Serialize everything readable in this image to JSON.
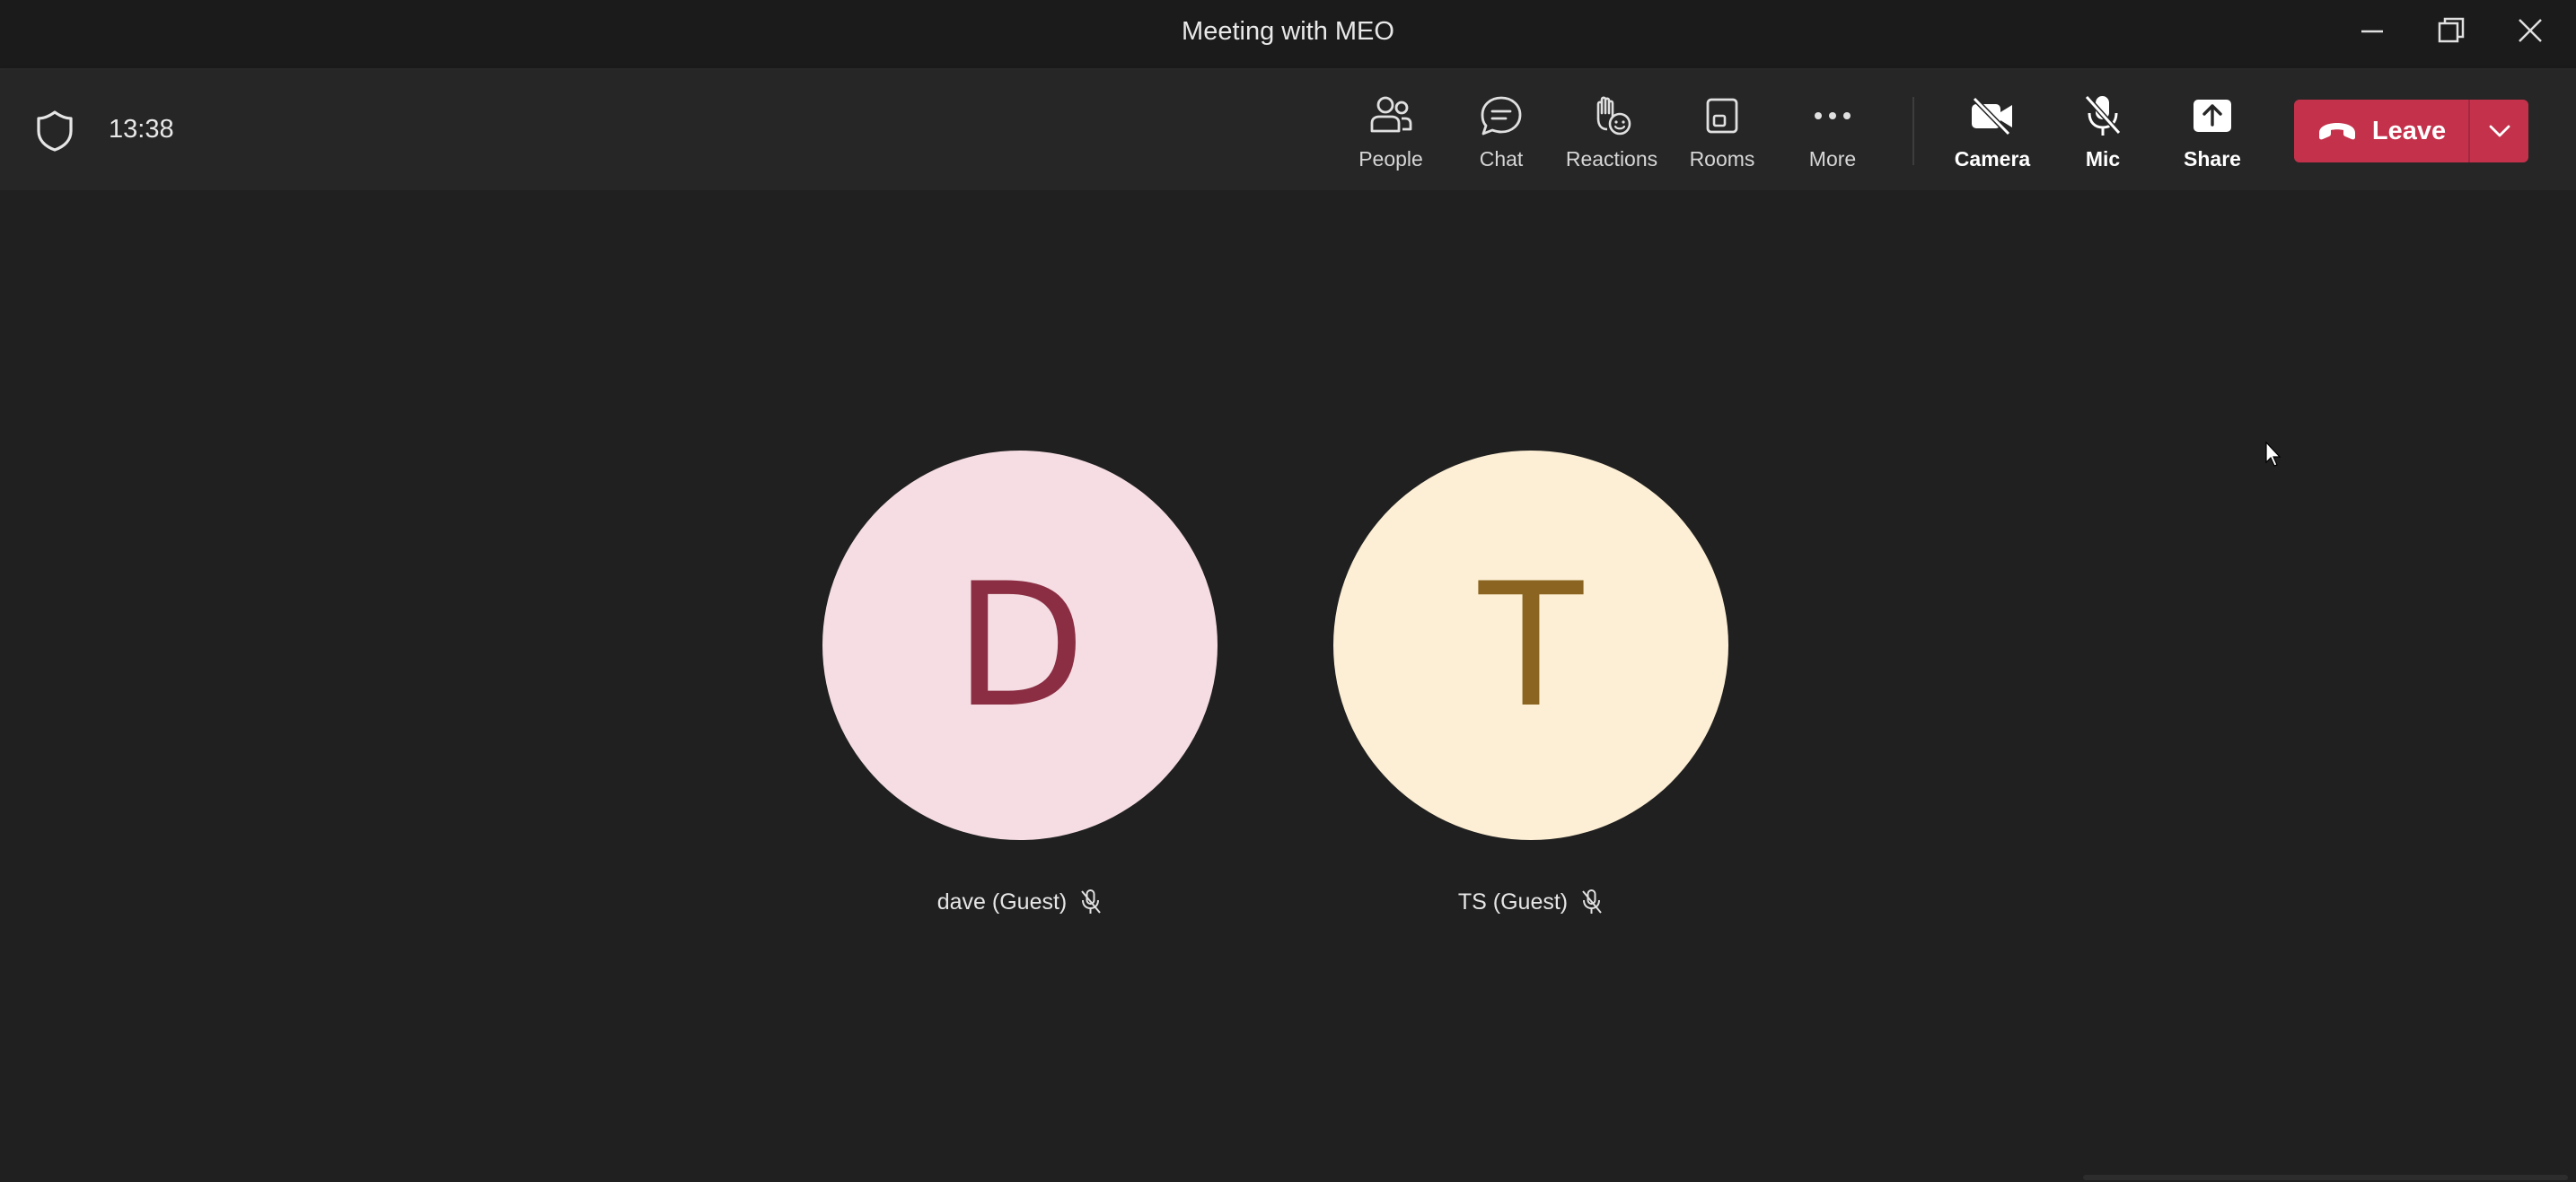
{
  "window": {
    "title": "Meeting with MEO",
    "controls": [
      "minimize-icon",
      "restore-icon",
      "close-icon"
    ]
  },
  "header": {
    "timer": "13:38",
    "security_icon": "shield-icon",
    "tools": [
      {
        "label": "People",
        "icon": "people-icon"
      },
      {
        "label": "Chat",
        "icon": "chat-icon"
      },
      {
        "label": "Reactions",
        "icon": "raise-hand-icon"
      },
      {
        "label": "Rooms",
        "icon": "breakout-rooms-icon"
      },
      {
        "label": "More",
        "icon": "more-icon"
      },
      {
        "label": "Camera",
        "icon": "camera-off-icon"
      },
      {
        "label": "Mic",
        "icon": "mic-off-icon"
      },
      {
        "label": "Share",
        "icon": "share-icon"
      }
    ],
    "leave": {
      "label": "Leave",
      "icon": "hang-up-icon",
      "accent": "#c4314b"
    }
  },
  "participants": [
    {
      "initial": "D",
      "name": "dave (Guest)",
      "muted": true,
      "avatar_bg": "#f5dde3",
      "avatar_fg": "#8b2e43"
    },
    {
      "initial": "T",
      "name": "TS (Guest)",
      "muted": true,
      "avatar_bg": "#fdefd5",
      "avatar_fg": "#8a6420"
    }
  ],
  "colors": {
    "background": "#202020",
    "header": "#262626",
    "titlebar": "#1b1b1b"
  }
}
